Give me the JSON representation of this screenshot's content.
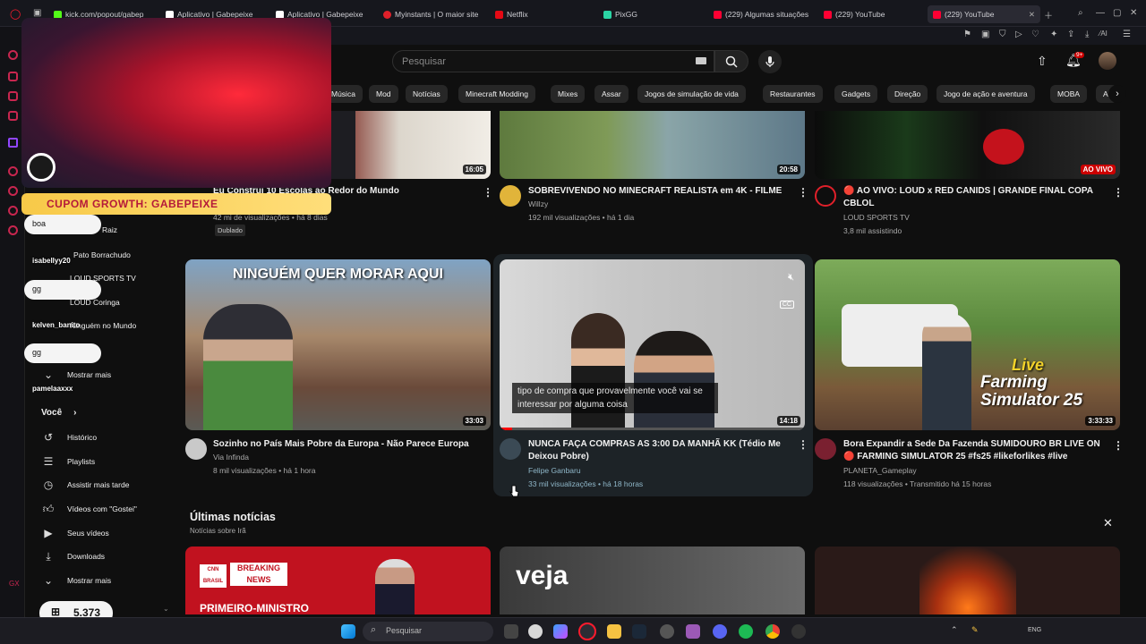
{
  "tabs": [
    {
      "label": "kick.com/popout/gabep",
      "color": "#53fc18"
    },
    {
      "label": "Aplicativo | Gabepeixe",
      "color": "#ffffff"
    },
    {
      "label": "Aplicativo | Gabepeixe",
      "color": "#ffffff"
    },
    {
      "label": "Myinstants | O maior site",
      "color": "#e0202a"
    },
    {
      "label": "Netflix",
      "color": "#e50914"
    },
    {
      "label": "PixGG",
      "color": "#2bd4a4"
    },
    {
      "label": "(229) Algumas situações",
      "color": "#ff0033"
    },
    {
      "label": "(229) YouTube",
      "color": "#ff0033"
    },
    {
      "label": "(229) YouTube",
      "color": "#ff0033"
    }
  ],
  "search": {
    "placeholder": "Pesquisar"
  },
  "notifications": {
    "badge": "9+"
  },
  "chips": [
    "Música",
    "Mod",
    "Notícias",
    "Minecraft Modding",
    "Mixes",
    "Assar",
    "Jogos de simulação de vida",
    "Restaurantes",
    "Gadgets",
    "Direção",
    "Jogo de ação e aventura",
    "MOBA",
    "A"
  ],
  "guide": {
    "subs": [
      "Raiz",
      "Pato Borrachudo",
      "LOUD SPORTS TV",
      "LOUD Coringa",
      "Ninguém no Mundo"
    ],
    "more_subs": "Mostrar mais",
    "you_label": "Você",
    "you_items": [
      "Histórico",
      "Playlists",
      "Assistir mais tarde",
      "Vídeos com \"Gostei\"",
      "Seus vídeos",
      "Downloads",
      "Mostrar mais"
    ]
  },
  "videos_row1": [
    {
      "title": "Eu Construí 10 Escolas ao Redor do Mundo",
      "channel": "",
      "meta": "42 mi de visualizações • há 8 dias",
      "badge": "Dublado",
      "duration": "16:05"
    },
    {
      "title": "SOBREVIVENDO NO MINECRAFT REALISTA em 4K - FILME",
      "channel": "Willzy",
      "meta": "192 mil visualizações • há 1 dia",
      "duration": "20:58"
    },
    {
      "title": "🔴 AO VIVO: LOUD x RED CANIDS | GRANDE FINAL COPA CBLOL",
      "channel": "LOUD SPORTS TV",
      "meta": "3,8 mil assistindo",
      "live": "AO VIVO"
    }
  ],
  "videos_row2": [
    {
      "title": "Sozinho no País Mais Pobre da Europa - Não Parece Europa",
      "thumb_text": "NINGUÉM QUER MORAR AQUI",
      "channel": "Via Infinda",
      "meta": "8 mil visualizações • há 1 hora",
      "duration": "33:03"
    },
    {
      "title": "NUNCA FAÇA COMPRAS AS 3:00 DA MANHÃ KK (Tédio Me Deixou Pobre)",
      "channel": "Felipe Ganbaru",
      "meta": "33 mil visualizações • há 18 horas",
      "duration": "14:18",
      "caption": "tipo de compra que provavelmente você vai se interessar por alguma coisa",
      "cc": "CC"
    },
    {
      "title": "Bora Expandir a Sede Da Fazenda SUMIDOURO BR LIVE ON 🔴 FARMING SIMULATOR 25 #fs25 #likeforlikes #live",
      "channel": "PLANETA_Gameplay",
      "meta": "118 visualizações • Transmitido há 15 horas",
      "duration": "3:33:33",
      "thumb_text": "Live",
      "thumb_text2": "Farming Simulator 25"
    }
  ],
  "news": {
    "title": "Últimas notícias",
    "subtitle": "Notícias sobre Irã",
    "cards": [
      "CNN BRASIL",
      "BREAKING NEWS",
      "PRIMEIRO-MINISTRO",
      "veja"
    ]
  },
  "overlay": {
    "coupon": "CUPOM GROWTH: GABEPEIXE",
    "chat": [
      {
        "msg": "boa"
      },
      {
        "name": "isabellyy20"
      },
      {
        "msg": "gg"
      },
      {
        "name": "kelven_banito"
      },
      {
        "msg": "gg"
      },
      {
        "name": "pamelaaxxx"
      }
    ],
    "coins": "5.373"
  },
  "taskbar": {
    "search_placeholder": "Pesquisar"
  }
}
